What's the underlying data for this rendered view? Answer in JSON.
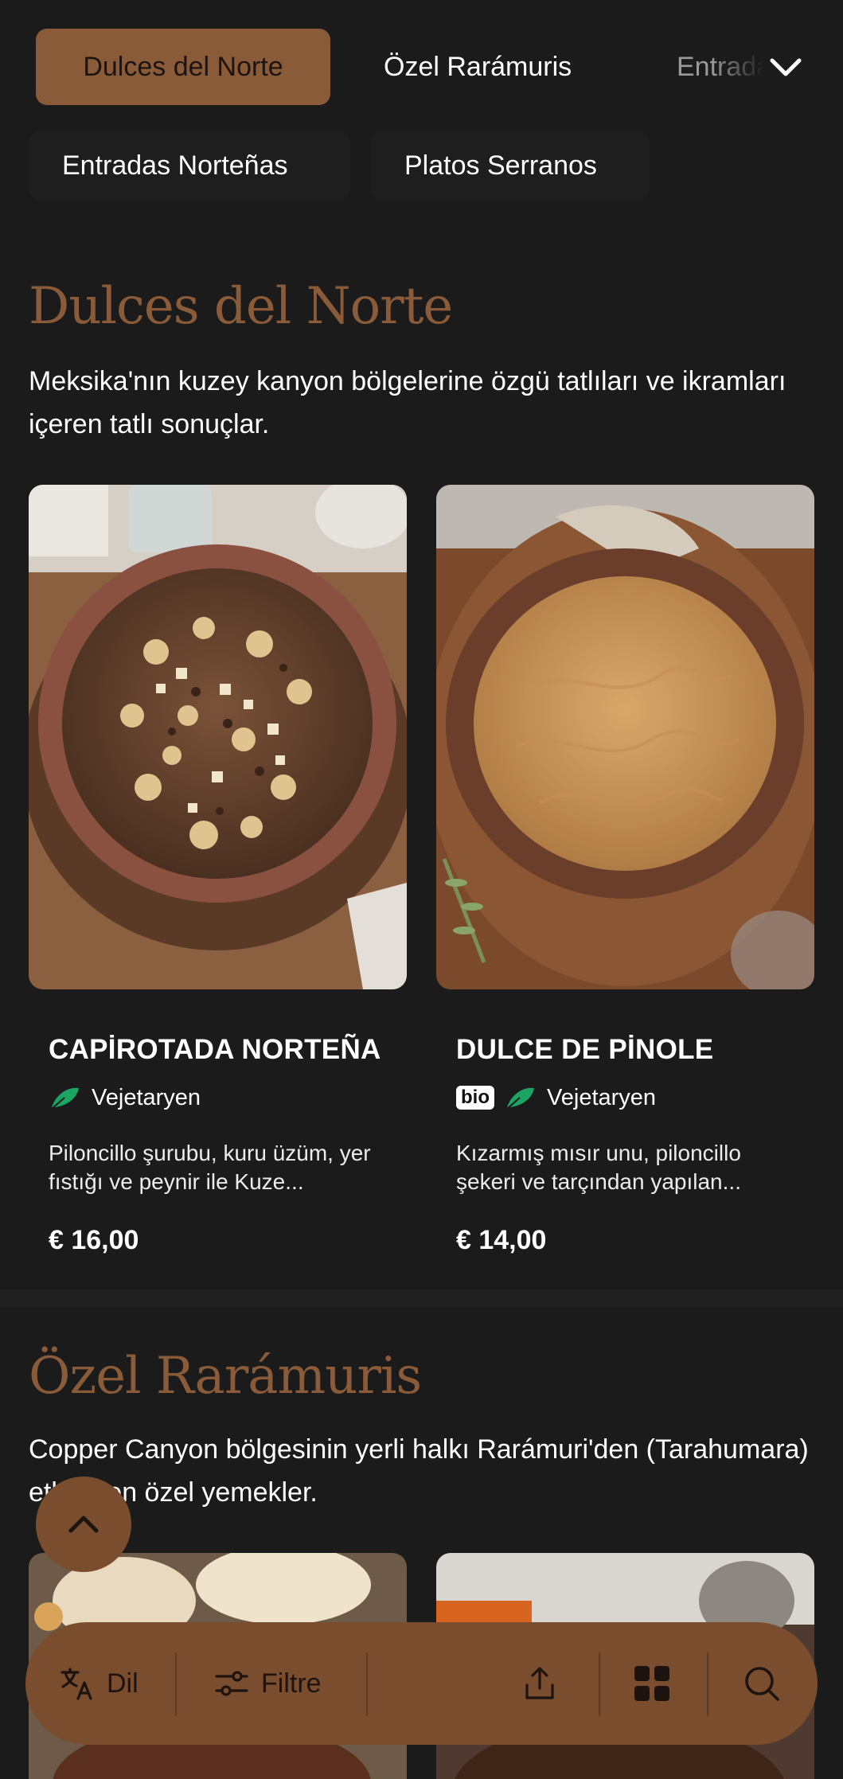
{
  "nav": {
    "tabs": [
      {
        "label": "Dulces del Norte",
        "active": true
      },
      {
        "label": "Özel Rarámuris",
        "active": false
      },
      {
        "label": "Entradas Norteñas",
        "active": false
      }
    ],
    "overflow_icon": "chevron-down-icon",
    "subtabs": [
      {
        "label": "Entradas Norteñas"
      },
      {
        "label": "Platos Serranos"
      }
    ]
  },
  "sections": [
    {
      "title": "Dulces del Norte",
      "description": "Meksika'nın kuzey kanyon bölgelerine özgü tatlıları ve ikramları içeren tatlı sonuçlar.",
      "items": [
        {
          "name": "CAPİROTADA NORTEÑA",
          "tags": [
            "Vejetaryen"
          ],
          "bio": false,
          "description": "Piloncillo şurubu, kuru üzüm, yer fıstığı ve peynir ile Kuze...",
          "price": "€ 16,00"
        },
        {
          "name": "DULCE DE PİNOLE",
          "tags": [
            "Vejetaryen"
          ],
          "bio": true,
          "bio_label": "bio",
          "description": "Kızarmış mısır unu, piloncillo şekeri ve tarçından yapılan...",
          "price": "€ 14,00"
        }
      ]
    },
    {
      "title": "Özel Rarámuris",
      "description": "Copper Canyon bölgesinin yerli halkı Rarámuri'den (Tarahumara) etkilenen özel yemekler."
    }
  ],
  "bottom_bar": {
    "language_label": "Dil",
    "filter_label": "Filtre",
    "icons": [
      "translate-icon",
      "filter-icon",
      "share-icon",
      "grid-icon",
      "search-icon"
    ]
  },
  "colors": {
    "background": "#1b1b1c",
    "accent": "#8a5b38",
    "bar": "#7a4d2e",
    "leaf": "#1aa563"
  }
}
